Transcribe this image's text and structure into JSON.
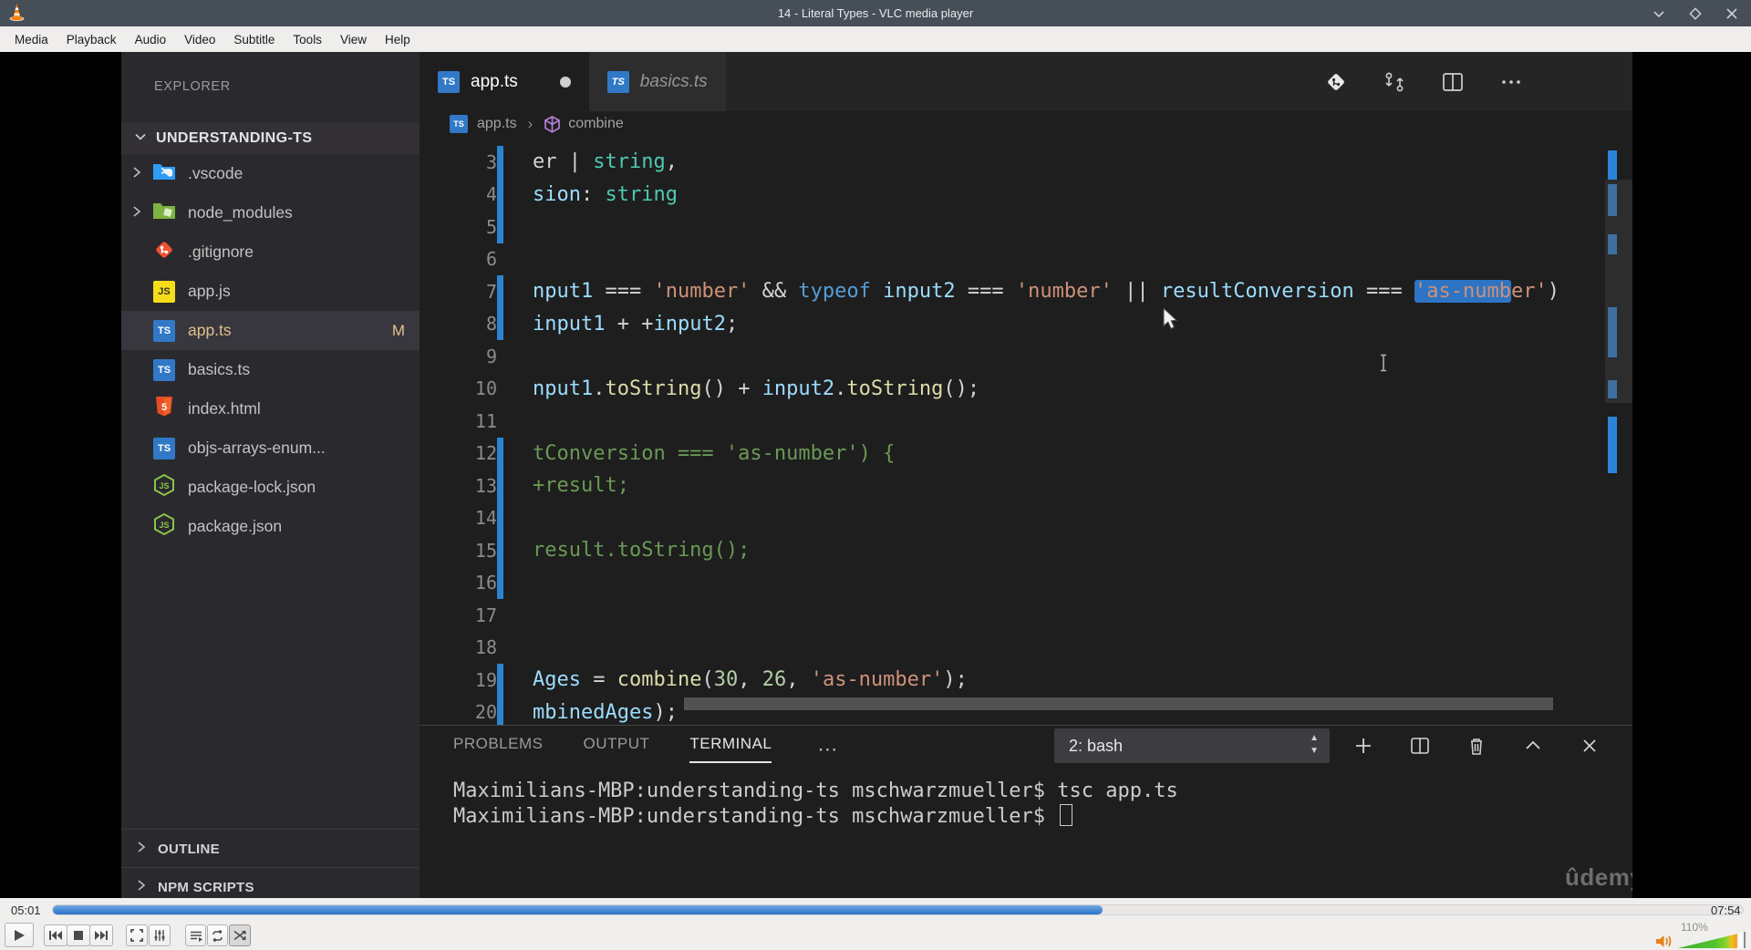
{
  "vlc": {
    "window_title": "14 - Literal Types - VLC media player",
    "menu_items": [
      "Media",
      "Playback",
      "Audio",
      "Video",
      "Subtitle",
      "Tools",
      "View",
      "Help"
    ],
    "window_controls": [
      "minimize",
      "restore",
      "close"
    ],
    "elapsed_time": "05:01",
    "total_time": "07:54",
    "volume_label": "110%",
    "seek_fraction": 0.621,
    "transport_controls": [
      "play",
      "previous",
      "stop",
      "next",
      "fullscreen",
      "settings",
      "playlist",
      "loop",
      "shuffle"
    ]
  },
  "vscode": {
    "explorer": {
      "title": "EXPLORER",
      "workspace": "UNDERSTANDING-TS",
      "items": [
        {
          "label": ".vscode",
          "icon": "folder-vscode",
          "chevron": true
        },
        {
          "label": "node_modules",
          "icon": "folder-node",
          "chevron": true
        },
        {
          "label": ".gitignore",
          "icon": "git"
        },
        {
          "label": "app.js",
          "icon": "js"
        },
        {
          "label": "app.ts",
          "icon": "ts",
          "selected": true,
          "badge": "M"
        },
        {
          "label": "basics.ts",
          "icon": "ts"
        },
        {
          "label": "index.html",
          "icon": "html"
        },
        {
          "label": "objs-arrays-enum...",
          "icon": "ts"
        },
        {
          "label": "package-lock.json",
          "icon": "node"
        },
        {
          "label": "package.json",
          "icon": "node"
        }
      ],
      "bottom_sections": [
        "OUTLINE",
        "NPM SCRIPTS"
      ]
    },
    "tabs": [
      {
        "label": "app.ts",
        "active": true,
        "modified": true
      },
      {
        "label": "basics.ts",
        "preview": true
      }
    ],
    "breadcrumb": {
      "file": "app.ts",
      "separator": "›",
      "symbol": "combine"
    },
    "editor_lines": [
      {
        "n": "3",
        "bar": true,
        "tokens": [
          [
            "er | ",
            "plain"
          ],
          [
            "string",
            "type"
          ],
          [
            ",",
            "plain"
          ]
        ]
      },
      {
        "n": "4",
        "bar": true,
        "tokens": [
          [
            "sion",
            "var"
          ],
          [
            ": ",
            "plain"
          ],
          [
            "string",
            "type"
          ]
        ]
      },
      {
        "n": "5",
        "bar": true,
        "tokens": []
      },
      {
        "n": "6",
        "bar": false,
        "tokens": []
      },
      {
        "n": "7",
        "bar": true,
        "tokens": [
          [
            "nput1",
            "var"
          ],
          [
            " === ",
            "plain"
          ],
          [
            "'number'",
            "str"
          ],
          [
            " && ",
            "plain"
          ],
          [
            "typeof",
            "kw"
          ],
          [
            " ",
            "plain"
          ],
          [
            "input2",
            "var"
          ],
          [
            " === ",
            "plain"
          ],
          [
            "'number'",
            "str"
          ],
          [
            " || ",
            "plain"
          ],
          [
            "resultConversion",
            "var"
          ],
          [
            " === ",
            "plain"
          ],
          [
            "'as-numb",
            "str",
            "sel"
          ],
          [
            "er'",
            "str"
          ],
          [
            ")",
            "plain"
          ]
        ]
      },
      {
        "n": "8",
        "bar": true,
        "tokens": [
          [
            "input1",
            "var"
          ],
          [
            " + +",
            "plain"
          ],
          [
            "input2",
            "var"
          ],
          [
            ";",
            "plain"
          ]
        ]
      },
      {
        "n": "9",
        "bar": false,
        "tokens": []
      },
      {
        "n": "10",
        "bar": false,
        "tokens": [
          [
            "nput1",
            "var"
          ],
          [
            ".",
            "plain"
          ],
          [
            "toString",
            "fn"
          ],
          [
            "() + ",
            "plain"
          ],
          [
            "input2",
            "var"
          ],
          [
            ".",
            "plain"
          ],
          [
            "toString",
            "fn"
          ],
          [
            "();",
            "plain"
          ]
        ]
      },
      {
        "n": "11",
        "bar": false,
        "tokens": []
      },
      {
        "n": "12",
        "bar": true,
        "tokens": [
          [
            "tConversion === 'as-number') {",
            "comment"
          ]
        ]
      },
      {
        "n": "13",
        "bar": true,
        "tokens": [
          [
            "+result;",
            "comment"
          ]
        ]
      },
      {
        "n": "14",
        "bar": true,
        "tokens": []
      },
      {
        "n": "15",
        "bar": true,
        "tokens": [
          [
            "result.toString();",
            "comment"
          ]
        ]
      },
      {
        "n": "16",
        "bar": true,
        "tokens": []
      },
      {
        "n": "17",
        "bar": false,
        "tokens": []
      },
      {
        "n": "18",
        "bar": false,
        "tokens": []
      },
      {
        "n": "19",
        "bar": true,
        "tokens": [
          [
            "Ages",
            "var"
          ],
          [
            " = ",
            "plain"
          ],
          [
            "combine",
            "fn"
          ],
          [
            "(",
            "plain"
          ],
          [
            "30",
            "num"
          ],
          [
            ", ",
            "plain"
          ],
          [
            "26",
            "num"
          ],
          [
            ", ",
            "plain"
          ],
          [
            "'as-number'",
            "str"
          ],
          [
            ");",
            "plain"
          ]
        ]
      },
      {
        "n": "20",
        "bar": true,
        "tokens": [
          [
            "mbinedAges",
            "var"
          ],
          [
            ");",
            "plain"
          ]
        ]
      }
    ],
    "editor_actions": [
      "open-changes",
      "sync-changes",
      "split-editor",
      "more-actions"
    ],
    "panel": {
      "tabs": [
        "PROBLEMS",
        "OUTPUT",
        "TERMINAL"
      ],
      "active_tab": "TERMINAL",
      "more_label": "⋯",
      "shell_selector": "2: bash",
      "action_icons": [
        "new-terminal",
        "split-terminal",
        "kill-terminal",
        "maximize-panel",
        "close-panel"
      ],
      "terminal_lines": [
        {
          "text": "Maximilians-MBP:understanding-ts mschwarzmueller$ tsc app.ts",
          "cursor": false
        },
        {
          "text": "Maximilians-MBP:understanding-ts mschwarzmueller$ ",
          "cursor": true
        }
      ]
    },
    "watermark": "ûdemy"
  }
}
